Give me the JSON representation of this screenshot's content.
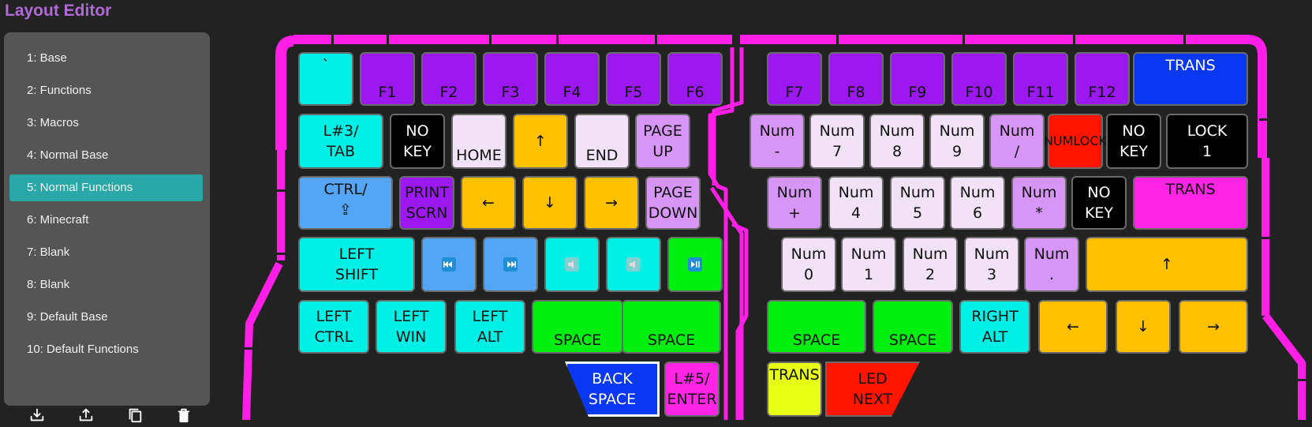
{
  "app": {
    "title": "Layout Editor"
  },
  "colors": {
    "outline": "#ff1ee6",
    "active_layer": "#2aa8a8",
    "cyan": "#00f0e6",
    "purple": "#9b18f0",
    "blue": "#0a38f0",
    "light_purple": "#d796f5",
    "lavender": "#f2e2f8",
    "orange": "#ffc000",
    "red": "#ff1400",
    "black": "#000000",
    "magenta": "#ff23e6",
    "sky": "#55a5f5",
    "green": "#00ee10",
    "yellow": "#e6ff14"
  },
  "sidebar": {
    "layers": [
      {
        "label": "1: Base"
      },
      {
        "label": "2: Functions"
      },
      {
        "label": "3: Macros"
      },
      {
        "label": "4: Normal Base"
      },
      {
        "label": "5: Normal Functions",
        "active": true
      },
      {
        "label": "6: Minecraft"
      },
      {
        "label": "7: Blank"
      },
      {
        "label": "8: Blank"
      },
      {
        "label": "9: Default Base"
      },
      {
        "label": "10: Default Functions"
      }
    ],
    "tools": [
      {
        "name": "download-icon"
      },
      {
        "name": "upload-icon"
      },
      {
        "name": "copy-icon"
      },
      {
        "name": "trash-icon"
      }
    ]
  },
  "keys": {
    "left_row1": [
      "`",
      "F1",
      "F2",
      "F3",
      "F4",
      "F5",
      "F6"
    ],
    "right_row1": [
      "F7",
      "F8",
      "F9",
      "F10",
      "F11",
      "F12",
      "TRANS"
    ],
    "left_row2": [
      "L#3/\nTAB",
      "NO\nKEY",
      "HOME",
      "↑",
      "END",
      "PAGE\nUP"
    ],
    "right_row2": [
      "Num\n-",
      "Num\n7",
      "Num\n8",
      "Num\n9",
      "Num\n/",
      "NUMLOCK",
      "NO\nKEY",
      "LOCK\n1"
    ],
    "left_row3": [
      "CTRL/\n⇪",
      "PRINT\nSCRN",
      "←",
      "↓",
      "→",
      "PAGE\nDOWN"
    ],
    "right_row3": [
      "Num\n+",
      "Num\n4",
      "Num\n5",
      "Num\n6",
      "Num\n*",
      "NO\nKEY",
      "TRANS"
    ],
    "left_row4": [
      "LEFT\nSHIFT"
    ],
    "left_row4_media": [
      "media-previous-icon",
      "media-next-icon",
      "volume-down-icon",
      "volume-up-icon",
      "play-pause-icon"
    ],
    "right_row4": [
      "Num\n0",
      "Num\n1",
      "Num\n2",
      "Num\n3",
      "Num\n.",
      "↑"
    ],
    "left_row5": [
      "LEFT\nCTRL",
      "LEFT\nWIN",
      "LEFT\nALT",
      "SPACE",
      "SPACE"
    ],
    "right_row5": [
      "SPACE",
      "SPACE",
      "RIGHT\nALT",
      "←",
      "↓",
      "→"
    ],
    "left_thumb": [
      "BACK\nSPACE",
      "L#5/\nENTER"
    ],
    "right_thumb": [
      "TRANS",
      "LED\nNEXT"
    ]
  }
}
